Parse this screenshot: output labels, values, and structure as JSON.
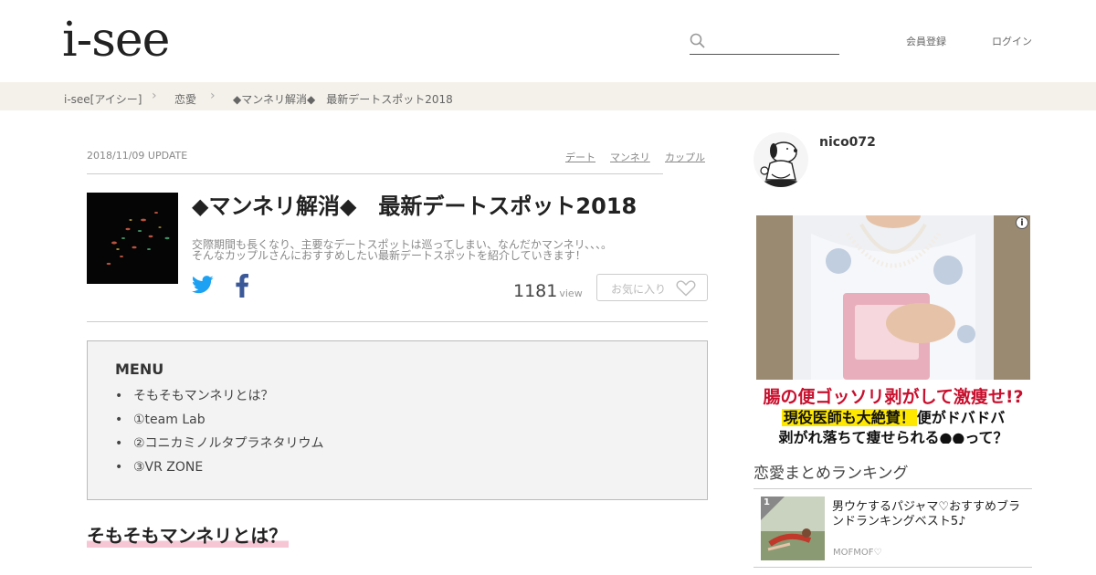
{
  "header": {
    "logo": "i-see",
    "search": {
      "value": "",
      "placeholder": ""
    },
    "register_label": "会員登録",
    "login_label": "ログイン"
  },
  "breadcrumb": [
    "i-see[アイシー]",
    "恋愛",
    "◆マンネリ解消◆　最新デートスポット2018"
  ],
  "article": {
    "date": "2018/11/09 UPDATE",
    "tags": [
      "デート",
      "マンネリ",
      "カップル"
    ],
    "title": "◆マンネリ解消◆　最新デートスポット2018",
    "description_lines": [
      "交際期間も長くなり、主要なデートスポットは巡ってしまい、なんだかマンネリ、、、。",
      "そんなカップルさんにおすすめしたい最新デートスポットを紹介していきます！"
    ],
    "views": "1181",
    "views_unit": "view",
    "favorite_label": "お気に入り",
    "menu": {
      "heading": "MENU",
      "items": [
        "そもそもマンネリとは？",
        "①team Lab",
        "②コニカミノルタプラネタリウム",
        "③VR ZONE"
      ]
    },
    "section_heading": "そもそもマンネリとは？"
  },
  "sidebar": {
    "username": "nico072",
    "ad": {
      "line1": "腸の便ゴッソリ剥がして激痩せ!?",
      "line2_highlight": "現役医師も大絶賛！",
      "line2_rest": "便がドバドバ",
      "line3": "剥がれ落ちて痩せられる●●って？"
    },
    "ranking_heading": "恋愛まとめランキング",
    "ranking": [
      {
        "rank": "1",
        "title": "男ウケするパジャマ♡おすすめブランドランキングベスト5♪",
        "author": "MOFMOF♡"
      }
    ]
  },
  "colors": {
    "crumb_bg": "#f4f1ea",
    "twitter": "#1da1f2",
    "facebook": "#3b5998",
    "heading_marker": "#f7c6d5",
    "ad_red": "#c8102e",
    "ad_yellow": "#ffe800"
  }
}
